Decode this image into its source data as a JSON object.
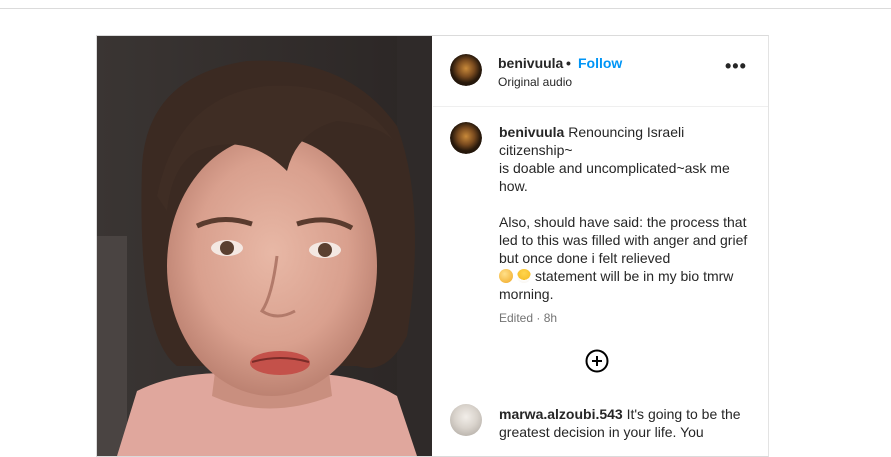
{
  "post": {
    "header": {
      "username": "benivuula",
      "separator": "•",
      "follow_label": "Follow",
      "audio_label": "Original audio",
      "more_label": "•••"
    },
    "caption": {
      "username": "benivuula",
      "line1": "Renouncing Israeli citizenship~",
      "line2": "is doable and uncomplicated~ask me how.",
      "line3": "Also, should have said: the process that led to this was filled with anger and grief but once done i felt relieved",
      "line4": "statement will be in my bio tmrw morning.",
      "emojis": [
        "relieved-face-emoji",
        "hatching-chick-emoji"
      ]
    },
    "meta": {
      "edited": "Edited",
      "dot": "·",
      "time": "8h"
    },
    "load_more_icon": "plus-circle-icon",
    "comments": [
      {
        "username": "marwa.alzoubi.543",
        "text": "It's going to be the greatest decision in your life. You"
      }
    ]
  },
  "colors": {
    "follow": "#0095f6",
    "text": "#262626",
    "secondary": "#737373",
    "border": "#dbdbdb"
  }
}
